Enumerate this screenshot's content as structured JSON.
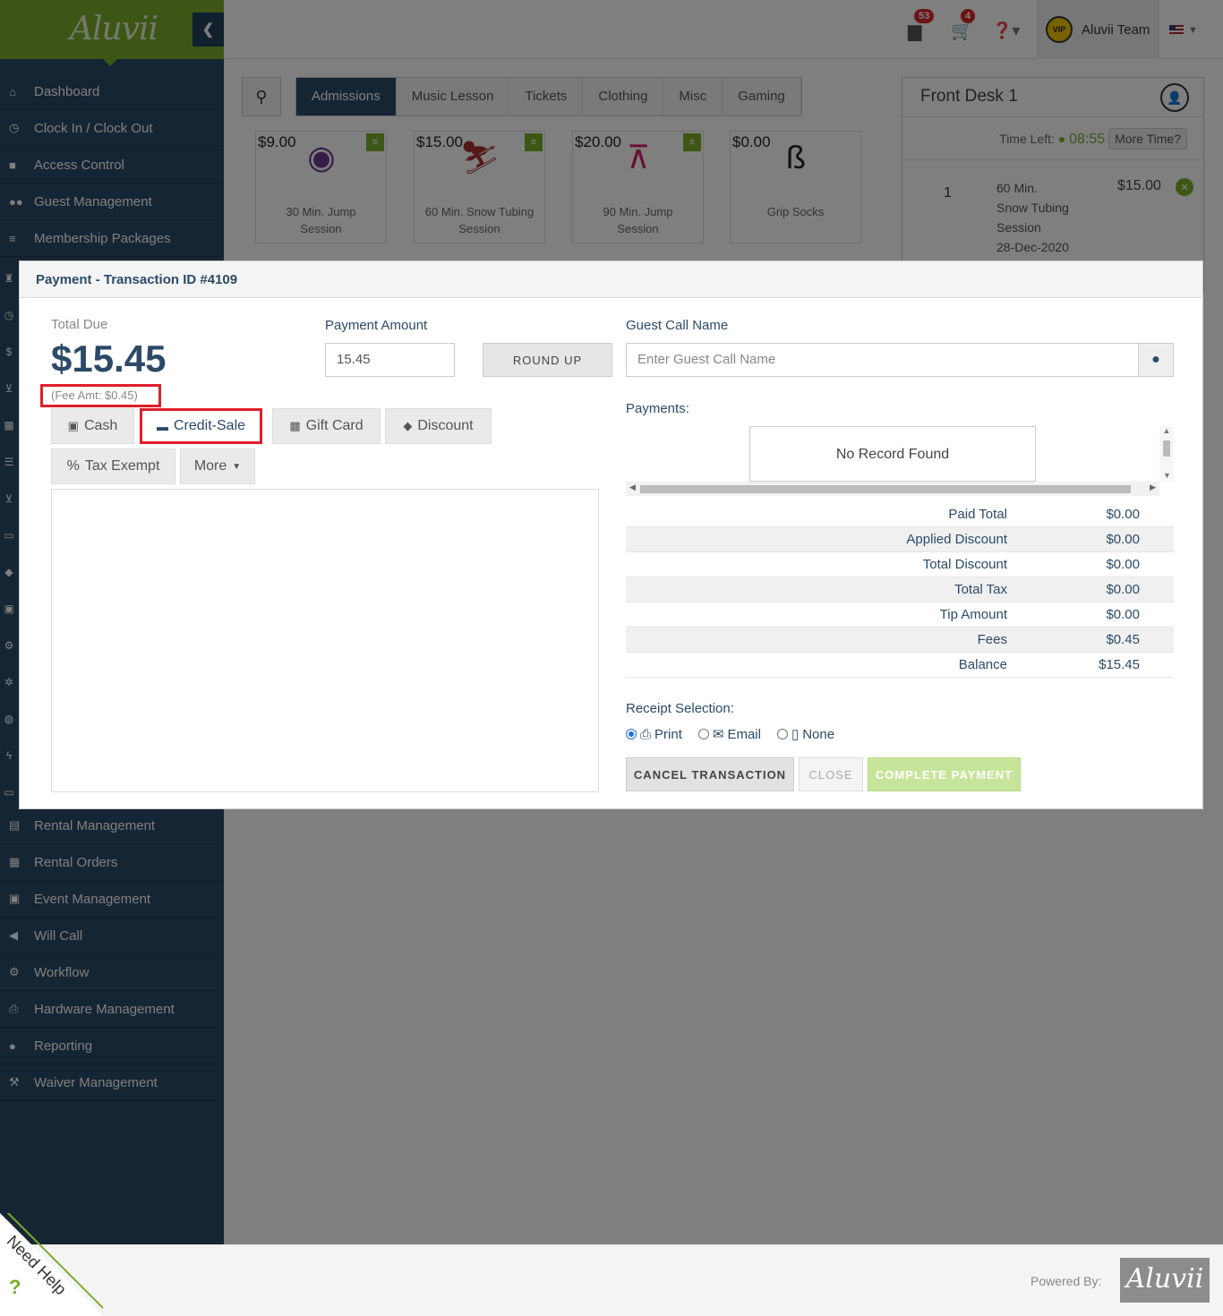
{
  "app": {
    "logo": "Aluvii",
    "collapse_icon": "chevron-left-icon"
  },
  "header": {
    "notifications_count": "53",
    "cart_count": "4",
    "help_icon": "question-circle-icon",
    "user_badge": "VIP",
    "user_name": "Aluvii Team"
  },
  "sidebar": {
    "items_top": [
      {
        "label": "Dashboard",
        "icon": "home-icon",
        "glyph": "⌂"
      },
      {
        "label": "Clock In / Clock Out",
        "icon": "clock-icon",
        "glyph": "◷"
      },
      {
        "label": "Access Control",
        "icon": "lock-icon",
        "glyph": "🔒"
      },
      {
        "label": "Guest Management",
        "icon": "users-icon",
        "glyph": "👥"
      },
      {
        "label": "Membership Packages",
        "icon": "list-icon",
        "glyph": "≡"
      }
    ],
    "items_bottom": [
      {
        "label": "Rental Management",
        "icon": "clipboard-icon",
        "glyph": "▤"
      },
      {
        "label": "Rental Orders",
        "icon": "document-icon",
        "glyph": "▦"
      },
      {
        "label": "Event Management",
        "icon": "calendar-check-icon",
        "glyph": "▣"
      },
      {
        "label": "Will Call",
        "icon": "megaphone-icon",
        "glyph": "◀"
      },
      {
        "label": "Workflow",
        "icon": "gear-icon",
        "glyph": "⚙"
      },
      {
        "label": "Hardware Management",
        "icon": "printer-icon",
        "glyph": "⎙"
      },
      {
        "label": "Reporting",
        "icon": "lightbulb-icon",
        "glyph": "●"
      },
      {
        "label": "Waiver Management",
        "icon": "gavel-icon",
        "glyph": "⚒"
      }
    ]
  },
  "pos": {
    "tabs": [
      "Admissions",
      "Music Lesson",
      "Tickets",
      "Clothing",
      "Misc",
      "Gaming"
    ],
    "active_tab": "Admissions",
    "products": [
      {
        "price": "$9.00",
        "name_line1": "30 Min. Jump",
        "name_line2": "Session",
        "image": "30-minute-session-image",
        "glyph": "◉"
      },
      {
        "price": "$15.00",
        "name_line1": "60 Min. Snow Tubing",
        "name_line2": "Session",
        "image": "snow-tubing-image",
        "glyph": "⛷"
      },
      {
        "price": "$20.00",
        "name_line1": "90 Min. Jump",
        "name_line2": "Session",
        "image": "trampoline-image",
        "glyph": "🤸"
      },
      {
        "price": "$0.00",
        "name_line1": "Grip Socks",
        "name_line2": "",
        "image": "socks-image",
        "glyph": "🧦"
      }
    ],
    "front_desk": {
      "title": "Front Desk 1",
      "time_left_label": "Time Left:",
      "time_left": "08:55",
      "more_time": "More Time?",
      "item": {
        "qty": "1",
        "name_line1": "60 Min.",
        "name_line2": "Snow Tubing",
        "name_line3": "Session",
        "date": "28-Dec-2020",
        "price": "$15.00"
      }
    }
  },
  "modal": {
    "title": "Payment - Transaction ID #4109",
    "total_due_label": "Total Due",
    "total_due": "$15.45",
    "fee_amt": "(Fee Amt: $0.45)",
    "payment_amount_label": "Payment Amount",
    "payment_amount": "15.45",
    "round_up": "ROUND UP",
    "guest_call_name_label": "Guest Call Name",
    "guest_call_name_placeholder": "Enter Guest Call Name",
    "payments_label": "Payments:",
    "no_record": "No Record Found",
    "methods": [
      {
        "label": "Cash",
        "icon": "money-icon"
      },
      {
        "label": "Credit-Sale",
        "icon": "credit-card-icon"
      },
      {
        "label": "Gift Card",
        "icon": "gift-icon"
      },
      {
        "label": "Discount",
        "icon": "tag-icon"
      },
      {
        "label": "Tax Exempt",
        "icon": "percent-icon"
      },
      {
        "label": "More",
        "icon": "caret-down-icon"
      }
    ],
    "totals": [
      {
        "label": "Paid Total",
        "value": "$0.00"
      },
      {
        "label": "Applied Discount",
        "value": "$0.00"
      },
      {
        "label": "Total Discount",
        "value": "$0.00"
      },
      {
        "label": "Total Tax",
        "value": "$0.00"
      },
      {
        "label": "Tip Amount",
        "value": "$0.00"
      },
      {
        "label": "Fees",
        "value": "$0.45"
      },
      {
        "label": "Balance",
        "value": "$15.45"
      }
    ],
    "receipt_label": "Receipt Selection:",
    "receipt_options": [
      "Print",
      "Email",
      "None"
    ],
    "receipt_selected": "Print",
    "cancel": "CANCEL TRANSACTION",
    "close": "CLOSE",
    "complete": "COMPLETE PAYMENT"
  },
  "footer": {
    "powered_by": "Powered By:",
    "logo": "Aluvii",
    "need_help": "Need Help"
  },
  "colors": {
    "brand_green": "#7aad2a",
    "navy": "#2c4a68",
    "highlight_red": "#e01e2a"
  }
}
